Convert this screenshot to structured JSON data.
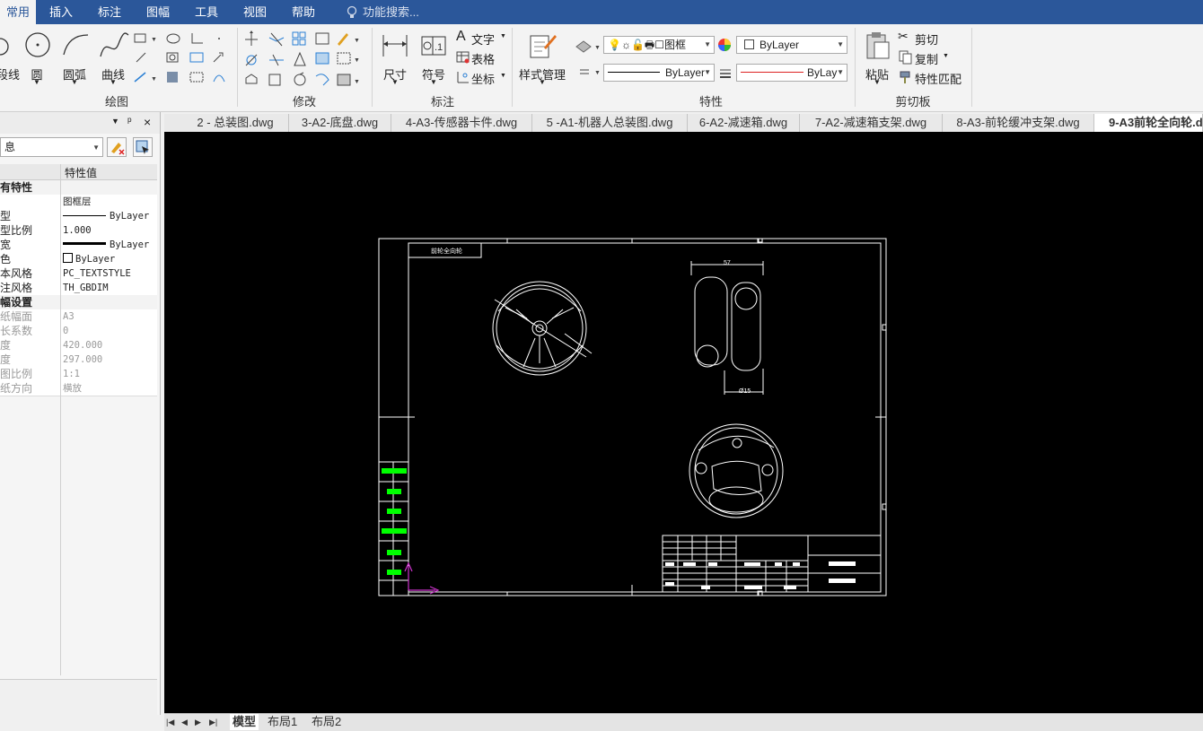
{
  "menu": {
    "items": [
      "常用",
      "插入",
      "标注",
      "图幅",
      "工具",
      "视图",
      "帮助"
    ],
    "search_placeholder": "功能搜索..."
  },
  "ribbon": {
    "draw": {
      "label": "绘图",
      "buttons": [
        "段线",
        "圆",
        "圆弧",
        "曲线"
      ]
    },
    "modify": {
      "label": "修改"
    },
    "annotate": {
      "label": "标注",
      "buttons": [
        "尺寸",
        "符号"
      ],
      "small": [
        "文字",
        "表格",
        "坐标"
      ]
    },
    "style": {
      "label": "样式管理"
    },
    "properties": {
      "label": "特性",
      "layer_value": "图框",
      "color_value": "ByLayer",
      "linetype_value": "ByLayer",
      "lineweight_value": "ByLay"
    },
    "clipboard": {
      "label": "剪切板",
      "paste": "粘贴",
      "items": [
        "剪切",
        "复制",
        "特性匹配"
      ]
    }
  },
  "panel": {
    "dropdown_value": "息",
    "header_key": "",
    "header_value": "特性值",
    "rows": [
      {
        "k": "有特性",
        "v": "",
        "type": "cat"
      },
      {
        "k": "",
        "v": "图框层",
        "type": "normal"
      },
      {
        "k": "型",
        "v": "ByLayer",
        "type": "normal"
      },
      {
        "k": "型比例",
        "v": "1.000",
        "type": "normal"
      },
      {
        "k": "宽",
        "v": "ByLayer",
        "type": "normal"
      },
      {
        "k": "色",
        "v": "ByLayer",
        "type": "normal"
      },
      {
        "k": "本风格",
        "v": "PC_TEXTSTYLE",
        "type": "normal"
      },
      {
        "k": "注风格",
        "v": "TH_GBDIM",
        "type": "normal"
      },
      {
        "k": "幅设置",
        "v": "",
        "type": "cat"
      },
      {
        "k": "纸幅面",
        "v": "A3",
        "type": "dim"
      },
      {
        "k": "长系数",
        "v": "0",
        "type": "dim"
      },
      {
        "k": "度",
        "v": "420.000",
        "type": "dim"
      },
      {
        "k": "度",
        "v": "297.000",
        "type": "dim"
      },
      {
        "k": "图比例",
        "v": "1:1",
        "type": "dim"
      },
      {
        "k": "纸方向",
        "v": "横放",
        "type": "dim"
      }
    ]
  },
  "tabs": [
    "2 - 总装图.dwg",
    "3-A2-底盘.dwg",
    "4-A3-传感器卡件.dwg",
    "5 -A1-机器人总装图.dwg",
    "6-A2-减速箱.dwg",
    "7-A2-减速箱支架.dwg",
    "8-A3-前轮缓冲支架.dwg",
    "9-A3前轮全向轮.d"
  ],
  "drawing": {
    "title_box_text": "前轮全向轮",
    "dim_top": "57",
    "dim_bottom": "Ø15"
  },
  "bottom_tabs": [
    "模型",
    "布局1",
    "布局2"
  ],
  "colors": {
    "menubar": "#2b579a",
    "canvas": "#000000",
    "drawing_lines": "#ffffff",
    "green_labels": "#00ff00",
    "ucs": "#cc33cc"
  }
}
